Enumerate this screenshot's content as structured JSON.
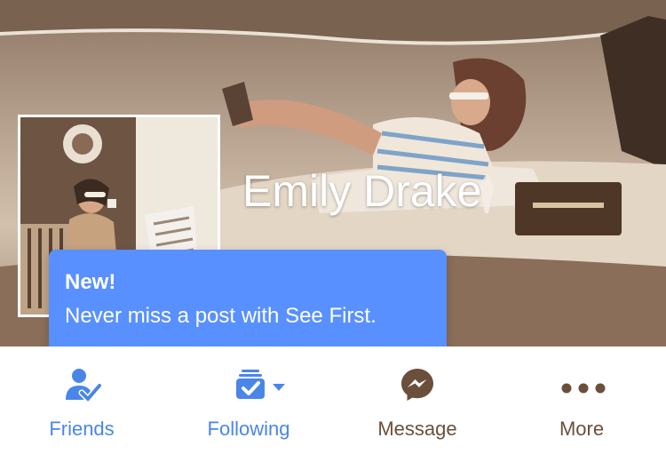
{
  "profile": {
    "name": "Emily Drake",
    "cover_photo": "woman-lounging-on-boat-illustration",
    "profile_photo": "woman-drinking-coffee-illustration"
  },
  "tooltip": {
    "title": "New!",
    "text": "Never miss a post with See First."
  },
  "actions": [
    {
      "label": "Friends",
      "icon": "friends-check-icon",
      "color": "#4a86e8"
    },
    {
      "label": "Following",
      "icon": "following-check-icon",
      "color": "#4a86e8"
    },
    {
      "label": "Message",
      "icon": "messenger-icon",
      "color": "#6b4f3a"
    },
    {
      "label": "More",
      "icon": "more-dots-icon",
      "color": "#6b4f3a"
    }
  ],
  "colors": {
    "tooltip_bg": "#5890ff",
    "active_action": "#4a86e8",
    "inactive_action": "#6b4f3a"
  }
}
